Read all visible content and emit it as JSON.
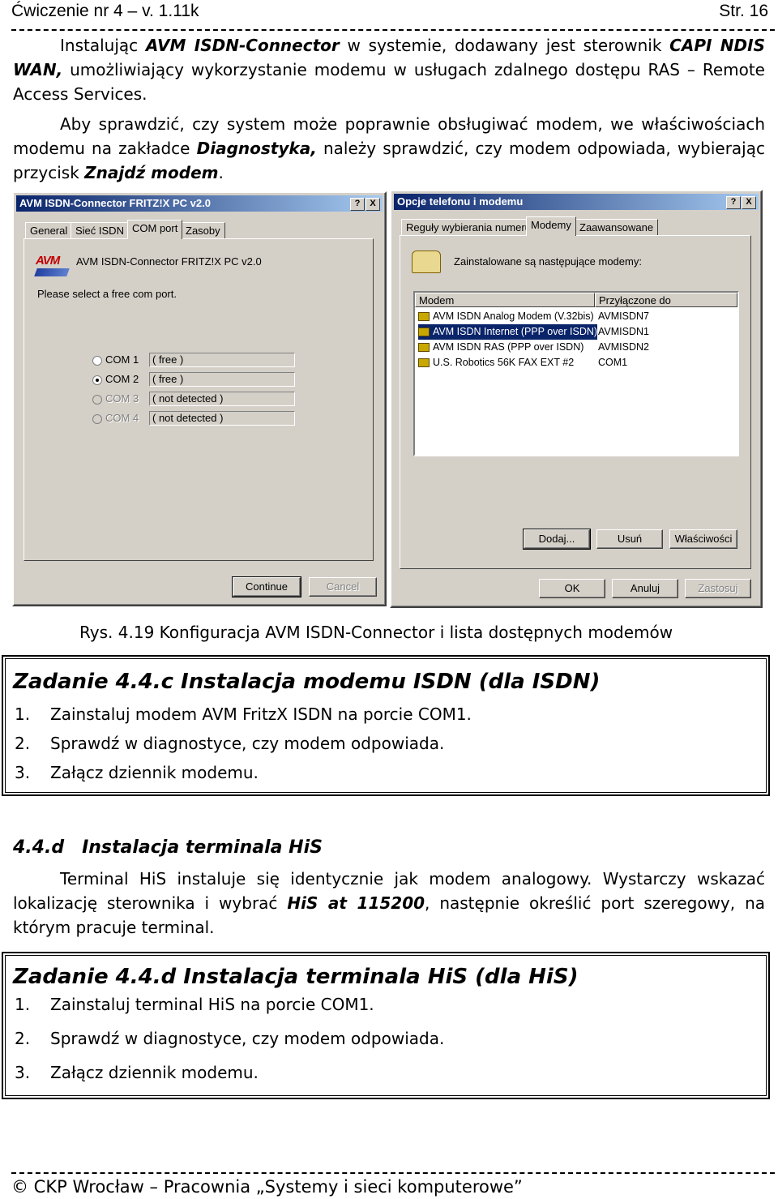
{
  "header": {
    "left": "Ćwiczenie nr 4 – v. 1.11k",
    "right": "Str. 16"
  },
  "intro": {
    "p1_a": "Instalując ",
    "p1_b": "AVM ISDN-Connector",
    "p1_c": " w systemie, dodawany jest sterownik ",
    "p1_d": "CAPI NDIS WAN,",
    "p1_e": " umożliwiający wykorzystanie modemu w usługach zdalnego dostępu RAS – Remote Access Services.",
    "p2_a": "Aby sprawdzić, czy system może poprawnie obsługiwać modem, we właściwościach modemu na zakładce ",
    "p2_b": "Diagnostyka,",
    "p2_c": " należy sprawdzić, czy modem odpowiada, wybierając przycisk ",
    "p2_d": "Znajdź modem",
    "p2_e": "."
  },
  "dialog1": {
    "title": "AVM ISDN-Connector FRITZ!X PC v2.0",
    "help_btn": "?",
    "close_btn": "X",
    "tabs": [
      "General",
      "Sieć ISDN",
      "COM port",
      "Zasoby"
    ],
    "product": "AVM ISDN-Connector FRITZ!X PC v2.0",
    "logo_text": "AVM",
    "prompt": "Please select a free com port.",
    "ports": [
      {
        "name": "COM 1",
        "status": "( free )",
        "selected": false,
        "enabled": true
      },
      {
        "name": "COM 2",
        "status": "( free )",
        "selected": true,
        "enabled": true
      },
      {
        "name": "COM 3",
        "status": "( not detected )",
        "selected": false,
        "enabled": false
      },
      {
        "name": "COM 4",
        "status": "( not detected )",
        "selected": false,
        "enabled": false
      }
    ],
    "continue_btn": "Continue",
    "cancel_btn": "Cancel"
  },
  "dialog2": {
    "title": "Opcje telefonu i modemu",
    "help_btn": "?",
    "close_btn": "X",
    "tabs": [
      "Reguły wybierania numeru",
      "Modemy",
      "Zaawansowane"
    ],
    "installed_text": "Zainstalowane są następujące modemy:",
    "columns": [
      "Modem",
      "Przyłączone do"
    ],
    "rows": [
      {
        "modem": "AVM ISDN Analog Modem (V.32bis)",
        "port": "AVMISDN7",
        "selected": false
      },
      {
        "modem": "AVM ISDN Internet (PPP over ISDN)",
        "port": "AVMISDN1",
        "selected": true
      },
      {
        "modem": "AVM ISDN RAS (PPP over ISDN)",
        "port": "AVMISDN2",
        "selected": false
      },
      {
        "modem": "U.S. Robotics 56K FAX EXT #2",
        "port": "COM1",
        "selected": false
      }
    ],
    "add_btn": "Dodaj...",
    "remove_btn": "Usuń",
    "props_btn": "Właściwości",
    "ok_btn": "OK",
    "cancel_btn": "Anuluj",
    "apply_btn": "Zastosuj"
  },
  "caption": "Rys. 4.19 Konfiguracja AVM ISDN-Connector i lista dostępnych modemów",
  "task1": {
    "title": "Zadanie 4.4.c Instalacja modemu ISDN (dla ISDN)",
    "items": [
      {
        "num": "1.",
        "text": "Zainstaluj modem AVM FritzX ISDN na porcie COM1."
      },
      {
        "num": "2.",
        "text": "Sprawdź w diagnostyce, czy modem odpowiada."
      },
      {
        "num": "3.",
        "text": "Załącz dziennik modemu."
      }
    ]
  },
  "section": {
    "number": "4.4.d",
    "title": "Instalacja terminala HiS",
    "p_a": "Terminal HiS instaluje się identycznie jak modem analogowy. Wystarczy wskazać lokalizację sterownika i wybrać ",
    "p_b": "HiS at 115200",
    "p_c": ", następnie określić port szeregowy, na którym pracuje terminal."
  },
  "task2": {
    "title": "Zadanie 4.4.d Instalacja terminala HiS (dla HiS)",
    "items": [
      {
        "num": "1.",
        "text": "Zainstaluj terminal HiS na porcie COM1."
      },
      {
        "num": "2.",
        "text": "Sprawdź w diagnostyce, czy modem odpowiada."
      },
      {
        "num": "3.",
        "text": "Załącz dziennik modemu."
      }
    ]
  },
  "footer": "© CKP Wrocław – Pracownia „Systemy i sieci komputerowe”"
}
